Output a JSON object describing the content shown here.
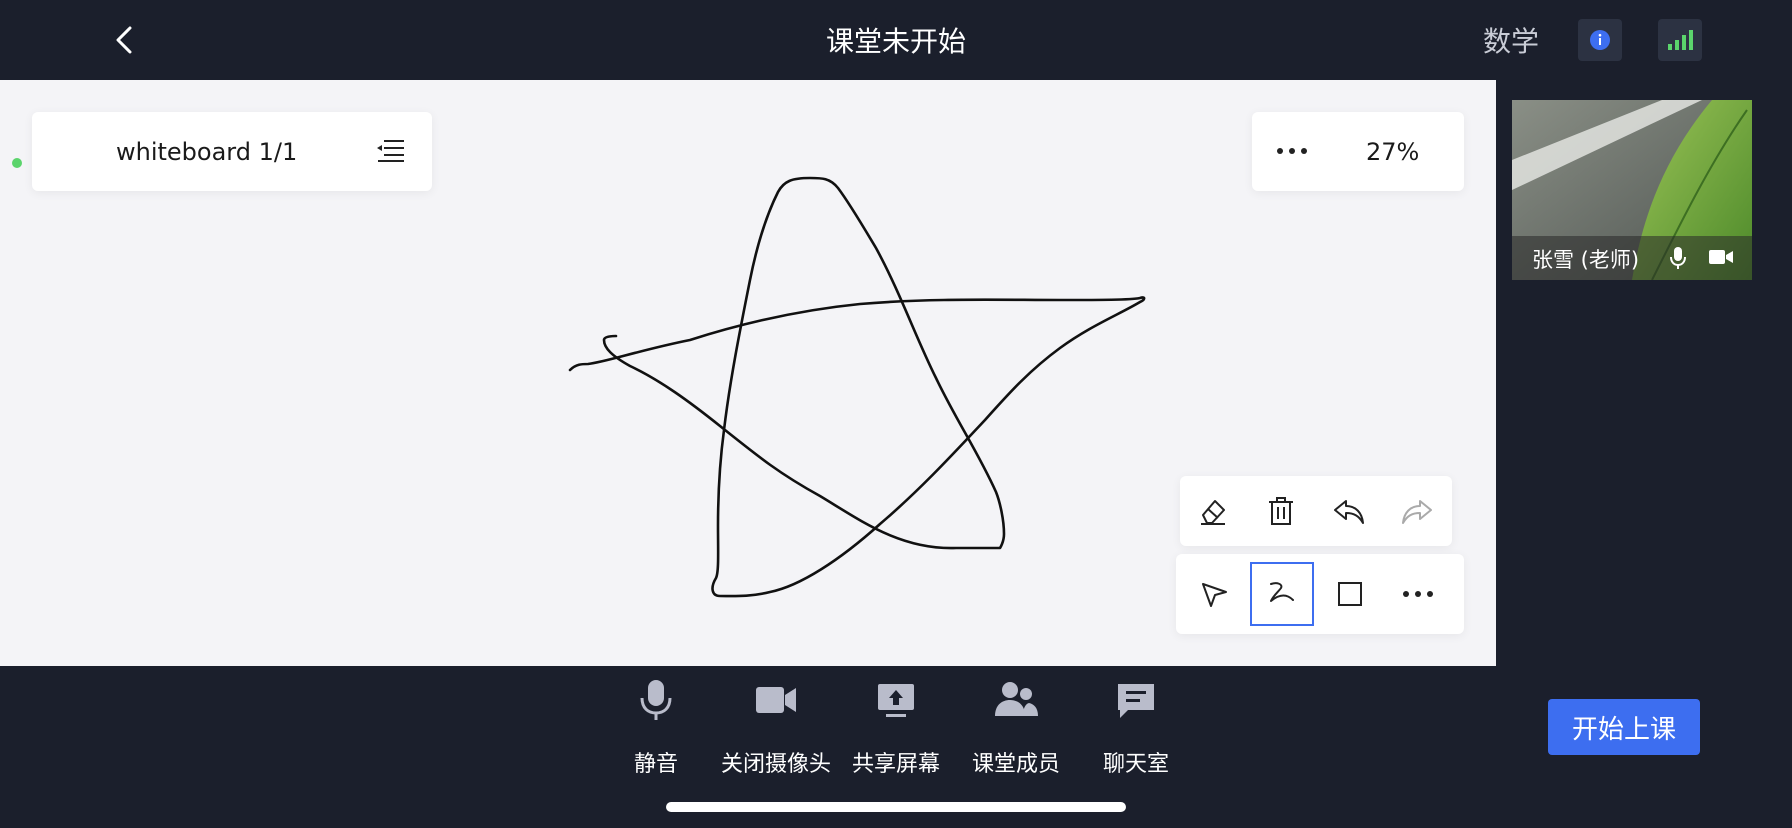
{
  "header": {
    "title": "课堂未开始",
    "subject": "数学"
  },
  "whiteboard": {
    "page_label": "whiteboard 1/1",
    "zoom": "27%"
  },
  "toolbar": {
    "row1": [
      "eraser-icon",
      "trash-icon",
      "undo-icon",
      "redo-icon"
    ],
    "row2": [
      "selector-icon",
      "pen-icon",
      "rectangle-icon",
      "more-icon"
    ],
    "active_tool": "pen-icon"
  },
  "video": {
    "name": "张雪 (老师)"
  },
  "bottom_bar": {
    "items": [
      {
        "label": "静音",
        "icon": "microphone-icon"
      },
      {
        "label": "关闭摄像头",
        "icon": "camera-icon"
      },
      {
        "label": "共享屏幕",
        "icon": "share-screen-icon"
      },
      {
        "label": "课堂成员",
        "icon": "members-icon"
      },
      {
        "label": "聊天室",
        "icon": "chat-icon"
      }
    ]
  },
  "start_button": {
    "label": "开始上课"
  },
  "colors": {
    "background": "#1b1f2c",
    "whiteboard": "#f4f4f7",
    "accent": "#3d6ef0",
    "signal": "#5bd46c"
  }
}
